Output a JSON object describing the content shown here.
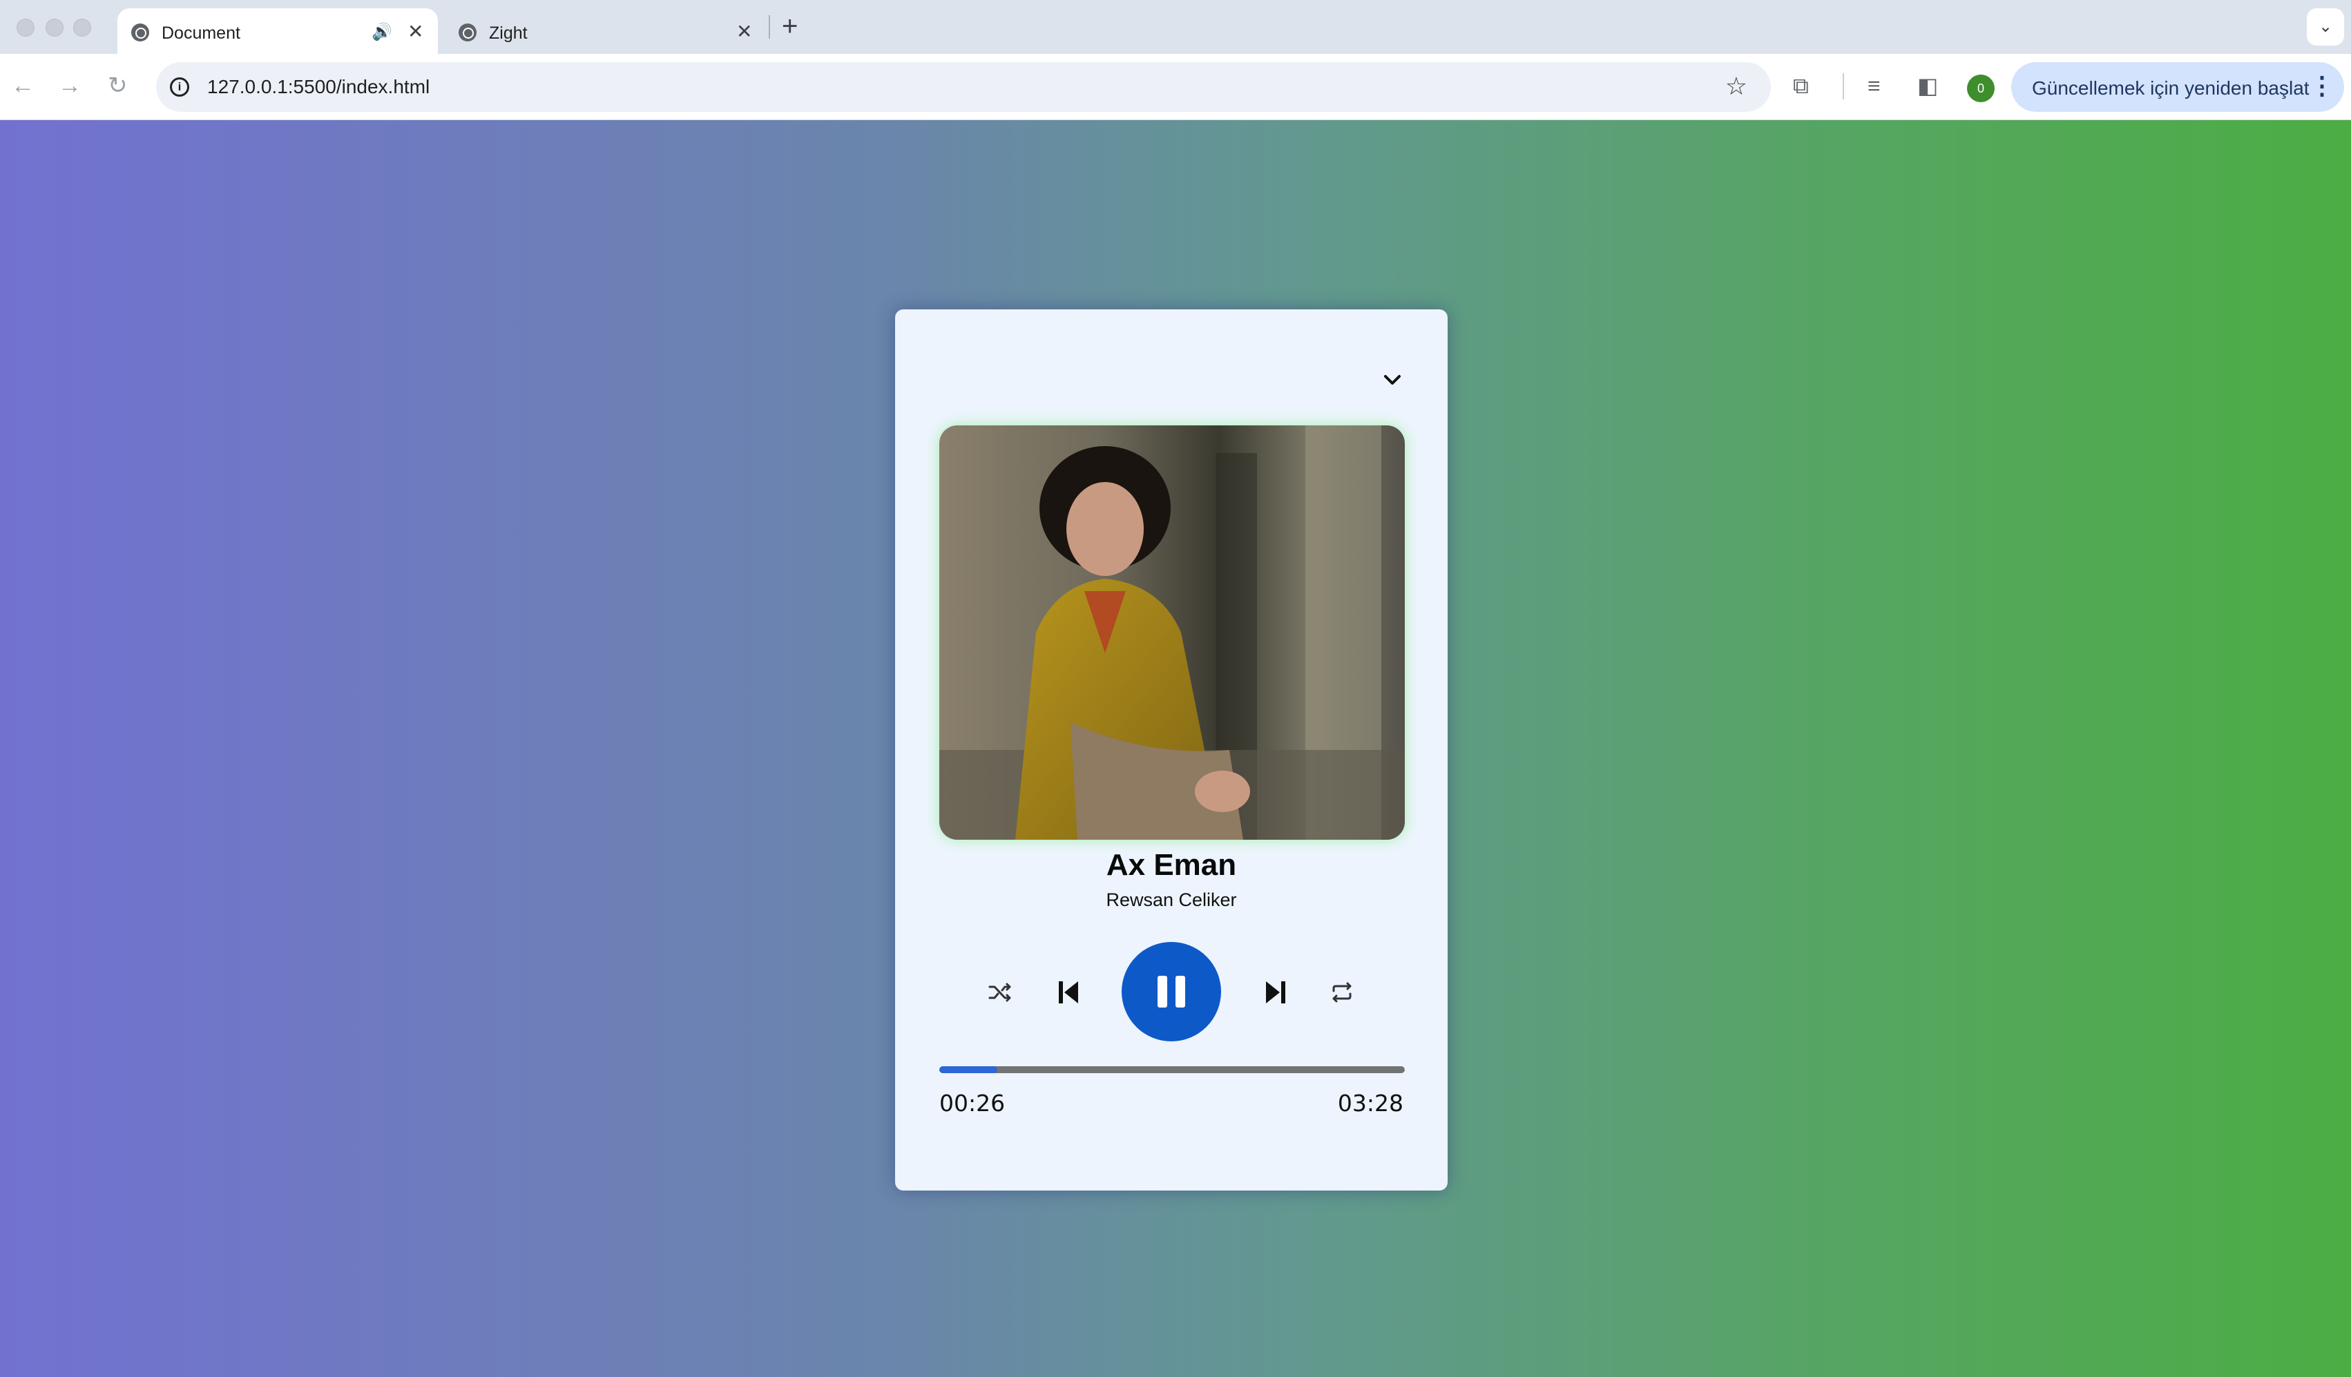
{
  "browser": {
    "tabs": [
      {
        "title": "Document",
        "active": true,
        "audio": true
      },
      {
        "title": "Zight",
        "active": false,
        "audio": false
      }
    ],
    "url": "127.0.0.1:5500/index.html",
    "profile_badge": "0",
    "update_button_label": "Güncellemek için yeniden başlat"
  },
  "player": {
    "song_title": "Ax Eman",
    "artist": "Rewsan Celiker",
    "current_time": "00:26",
    "total_time": "03:28",
    "progress_fraction": 0.125,
    "state": "playing",
    "accent_color": "#0d59c8",
    "card_color": "#edf4fd",
    "icons": [
      "chevron-down-icon",
      "shuffle-icon",
      "previous-icon",
      "pause-icon",
      "next-icon",
      "repeat-icon"
    ]
  }
}
